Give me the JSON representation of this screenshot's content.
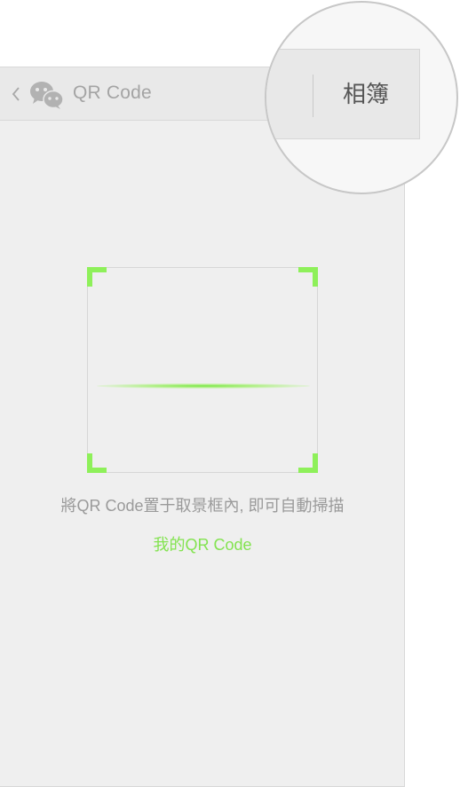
{
  "navbar": {
    "title": "QR Code",
    "back_icon": "chevron-left-icon",
    "app_icon": "wechat-icon"
  },
  "scanner": {
    "hint": "將QR Code置于取景框內, 即可自動掃描",
    "my_qr_link": "我的QR Code",
    "accent_color": "#8ef05a"
  },
  "magnifier": {
    "album_button": "相簿"
  }
}
